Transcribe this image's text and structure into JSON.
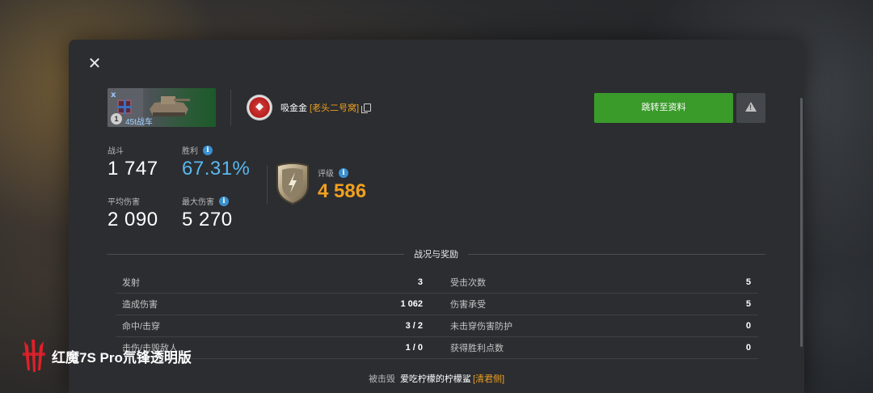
{
  "header": {
    "close_label": "✕"
  },
  "tank": {
    "tier_badge": "1",
    "tier_roman": "ⅹ",
    "name": "45t战车"
  },
  "player": {
    "name": "吸金金",
    "clan": "[老头二号窝]"
  },
  "buttons": {
    "profile_label": "跳转至资料"
  },
  "stats": {
    "battles_label": "战斗",
    "battles_value": "1 747",
    "win_label": "胜利",
    "win_value": "67.31%",
    "avg_dmg_label": "平均伤害",
    "avg_dmg_value": "2 090",
    "max_dmg_label": "最大伤害",
    "max_dmg_value": "5 270",
    "rating_label": "评级",
    "rating_value": "4 586"
  },
  "section": {
    "title": "战况与奖励"
  },
  "table": {
    "rows": [
      {
        "left_k": "发射",
        "left_v": "3",
        "right_k": "受击次数",
        "right_v": "5"
      },
      {
        "left_k": "造成伤害",
        "left_v": "1 062",
        "right_k": "伤害承受",
        "right_v": "5"
      },
      {
        "left_k": "命中/击穿",
        "left_v": "3 / 2",
        "right_k": "未击穿伤害防护",
        "right_v": "0"
      },
      {
        "left_k": "击伤/击毁敌人",
        "left_v": "1 / 0",
        "right_k": "获得胜利点数",
        "right_v": "0"
      }
    ]
  },
  "destroyed": {
    "label": "被击毁",
    "name": "爱吃柠檬的柠檬鲨",
    "clan": "[清君侧]"
  },
  "watermark": {
    "text": "红魔7S Pro氘锋透明版"
  },
  "colors": {
    "accent_green": "#3a9a2a",
    "accent_orange": "#f0a020",
    "accent_blue": "#5ab8f0"
  }
}
